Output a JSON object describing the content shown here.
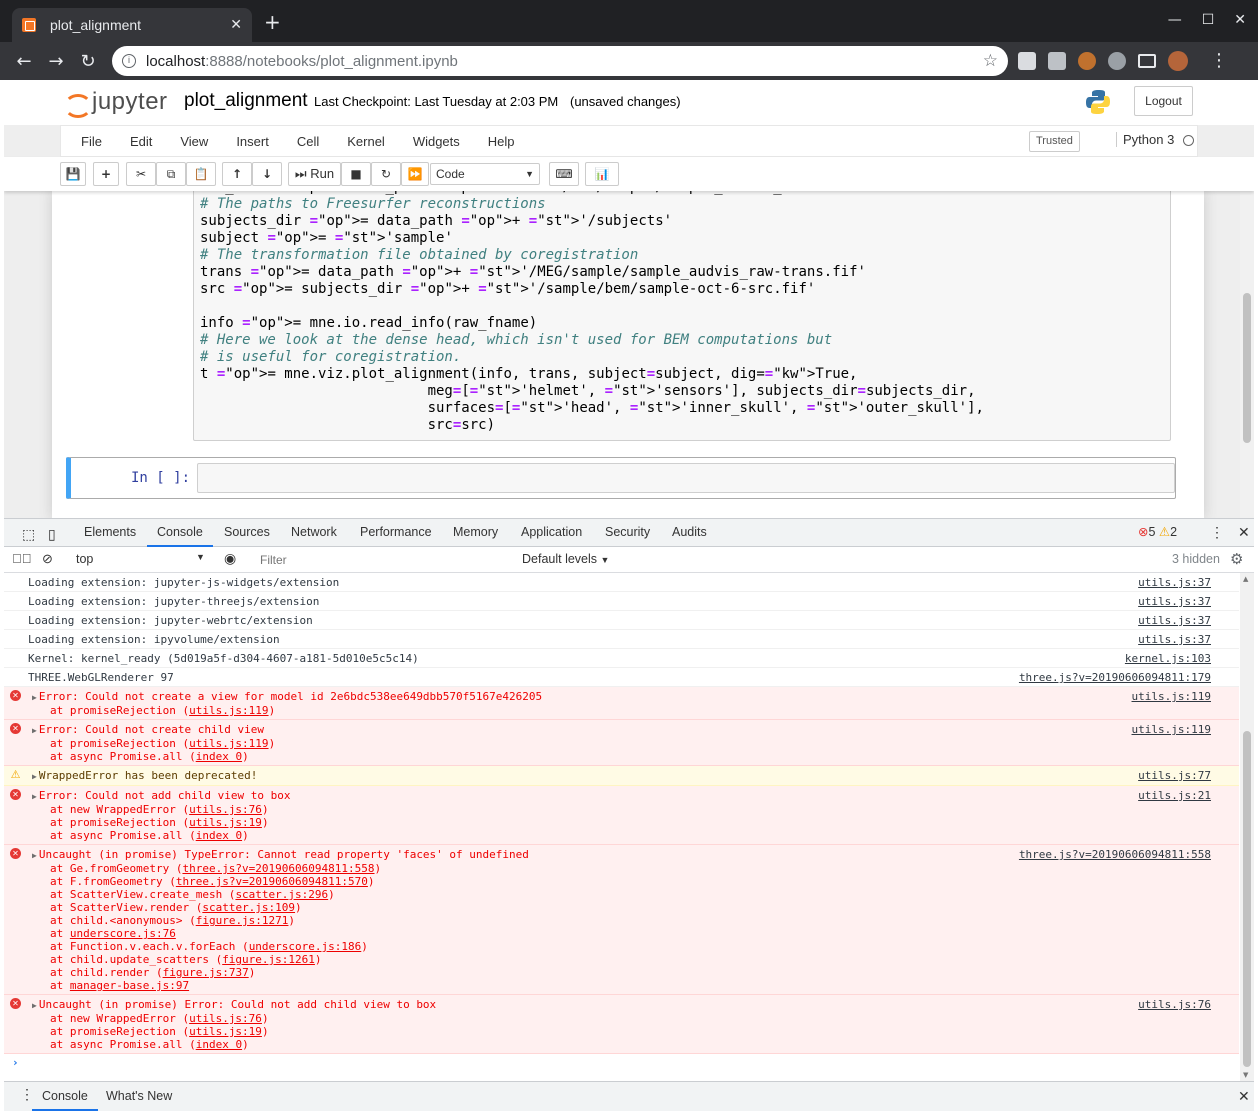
{
  "browser": {
    "tab_title": "plot_alignment",
    "url_host": "localhost",
    "url_rest": ":8888/notebooks/plot_alignment.ipynb"
  },
  "jupyter": {
    "logo_text": "jupyter",
    "notebook_name": "plot_alignment",
    "checkpoint": "Last Checkpoint: Last Tuesday at 2:03 PM",
    "unsaved": "(unsaved changes)",
    "logout": "Logout",
    "menu": [
      "File",
      "Edit",
      "View",
      "Insert",
      "Cell",
      "Kernel",
      "Widgets",
      "Help"
    ],
    "trusted": "Trusted",
    "kernel": "Python 3",
    "run_label": "Run",
    "cell_type": "Code",
    "input_prompt": "In [ ]:"
  },
  "code_lines": [
    "raw_fname = data_path + '/MEG/sample/sample_audvis_raw.fif'",
    "# The paths to Freesurfer reconstructions",
    "subjects_dir = data_path + '/subjects'",
    "subject = 'sample'",
    "# The transformation file obtained by coregistration",
    "trans = data_path + '/MEG/sample/sample_audvis_raw-trans.fif'",
    "src = subjects_dir + '/sample/bem/sample-oct-6-src.fif'",
    "",
    "info = mne.io.read_info(raw_fname)",
    "# Here we look at the dense head, which isn't used for BEM computations but",
    "# is useful for coregistration.",
    "t = mne.viz.plot_alignment(info, trans, subject=subject, dig=True,",
    "                           meg=['helmet', 'sensors'], subjects_dir=subjects_dir,",
    "                           surfaces=['head', 'inner_skull', 'outer_skull'],",
    "                           src=src)"
  ],
  "devtools": {
    "tabs": [
      "Elements",
      "Console",
      "Sources",
      "Network",
      "Performance",
      "Memory",
      "Application",
      "Security",
      "Audits"
    ],
    "active_tab": "Console",
    "error_count": "5",
    "warning_count": "2",
    "context": "top",
    "filter_placeholder": "Filter",
    "levels": "Default levels",
    "hidden": "3 hidden",
    "drawer_tabs": [
      "Console",
      "What's New"
    ]
  },
  "console": [
    {
      "level": "info",
      "msg": "Loading extension: jupyter-js-widgets/extension",
      "src": "utils.js:37",
      "stack": []
    },
    {
      "level": "info",
      "msg": "Loading extension: jupyter-threejs/extension",
      "src": "utils.js:37",
      "stack": []
    },
    {
      "level": "info",
      "msg": "Loading extension: jupyter-webrtc/extension",
      "src": "utils.js:37",
      "stack": []
    },
    {
      "level": "info",
      "msg": "Loading extension: ipyvolume/extension",
      "src": "utils.js:37",
      "stack": []
    },
    {
      "level": "info",
      "msg": "Kernel: kernel_ready (5d019a5f-d304-4607-a181-5d010e5c5c14)",
      "src": "kernel.js:103",
      "stack": []
    },
    {
      "level": "info",
      "msg": "THREE.WebGLRenderer 97",
      "src": "three.js?v=20190606094811:179",
      "stack": []
    },
    {
      "level": "error",
      "msg": "Error: Could not create a view for model id 2e6bdc538ee649dbb570f5167e426205",
      "src": "utils.js:119",
      "stack": [
        [
          "at promiseRejection (",
          "utils.js:119",
          ")"
        ]
      ]
    },
    {
      "level": "error",
      "msg": "Error: Could not create child view",
      "src": "utils.js:119",
      "stack": [
        [
          "at promiseRejection (",
          "utils.js:119",
          ")"
        ],
        [
          "at async Promise.all (",
          "index 0",
          ")"
        ]
      ]
    },
    {
      "level": "warn",
      "msg": "WrappedError has been deprecated!",
      "src": "utils.js:77",
      "stack": []
    },
    {
      "level": "error",
      "msg": "Error: Could not add child view to box",
      "src": "utils.js:21",
      "stack": [
        [
          "at new WrappedError (",
          "utils.js:76",
          ")"
        ],
        [
          "at promiseRejection (",
          "utils.js:19",
          ")"
        ],
        [
          "at async Promise.all (",
          "index 0",
          ")"
        ]
      ]
    },
    {
      "level": "error",
      "msg": "Uncaught (in promise) TypeError: Cannot read property 'faces' of undefined",
      "src": "three.js?v=20190606094811:558",
      "stack": [
        [
          "at Ge.fromGeometry (",
          "three.js?v=20190606094811:558",
          ")"
        ],
        [
          "at F.fromGeometry (",
          "three.js?v=20190606094811:570",
          ")"
        ],
        [
          "at ScatterView.create_mesh (",
          "scatter.js:296",
          ")"
        ],
        [
          "at ScatterView.render (",
          "scatter.js:109",
          ")"
        ],
        [
          "at child.<anonymous> (",
          "figure.js:1271",
          ")"
        ],
        [
          "at ",
          "underscore.js:76",
          ""
        ],
        [
          "at Function.v.each.v.forEach (",
          "underscore.js:186",
          ")"
        ],
        [
          "at child.update_scatters (",
          "figure.js:1261",
          ")"
        ],
        [
          "at child.render (",
          "figure.js:737",
          ")"
        ],
        [
          "at ",
          "manager-base.js:97",
          ""
        ]
      ]
    },
    {
      "level": "error",
      "msg": "Uncaught (in promise) Error: Could not add child view to box",
      "src": "utils.js:76",
      "stack": [
        [
          "at new WrappedError (",
          "utils.js:76",
          ")"
        ],
        [
          "at promiseRejection (",
          "utils.js:19",
          ")"
        ],
        [
          "at async Promise.all (",
          "index 0",
          ")"
        ]
      ]
    }
  ],
  "icons": {
    "favicon": "jupyter-book-icon",
    "star": "bookmark-star-icon"
  },
  "colors": {
    "accent": "#1a73e8",
    "error": "#e53935",
    "warning": "#f2a600",
    "cell_selected": "#42a5f5"
  }
}
